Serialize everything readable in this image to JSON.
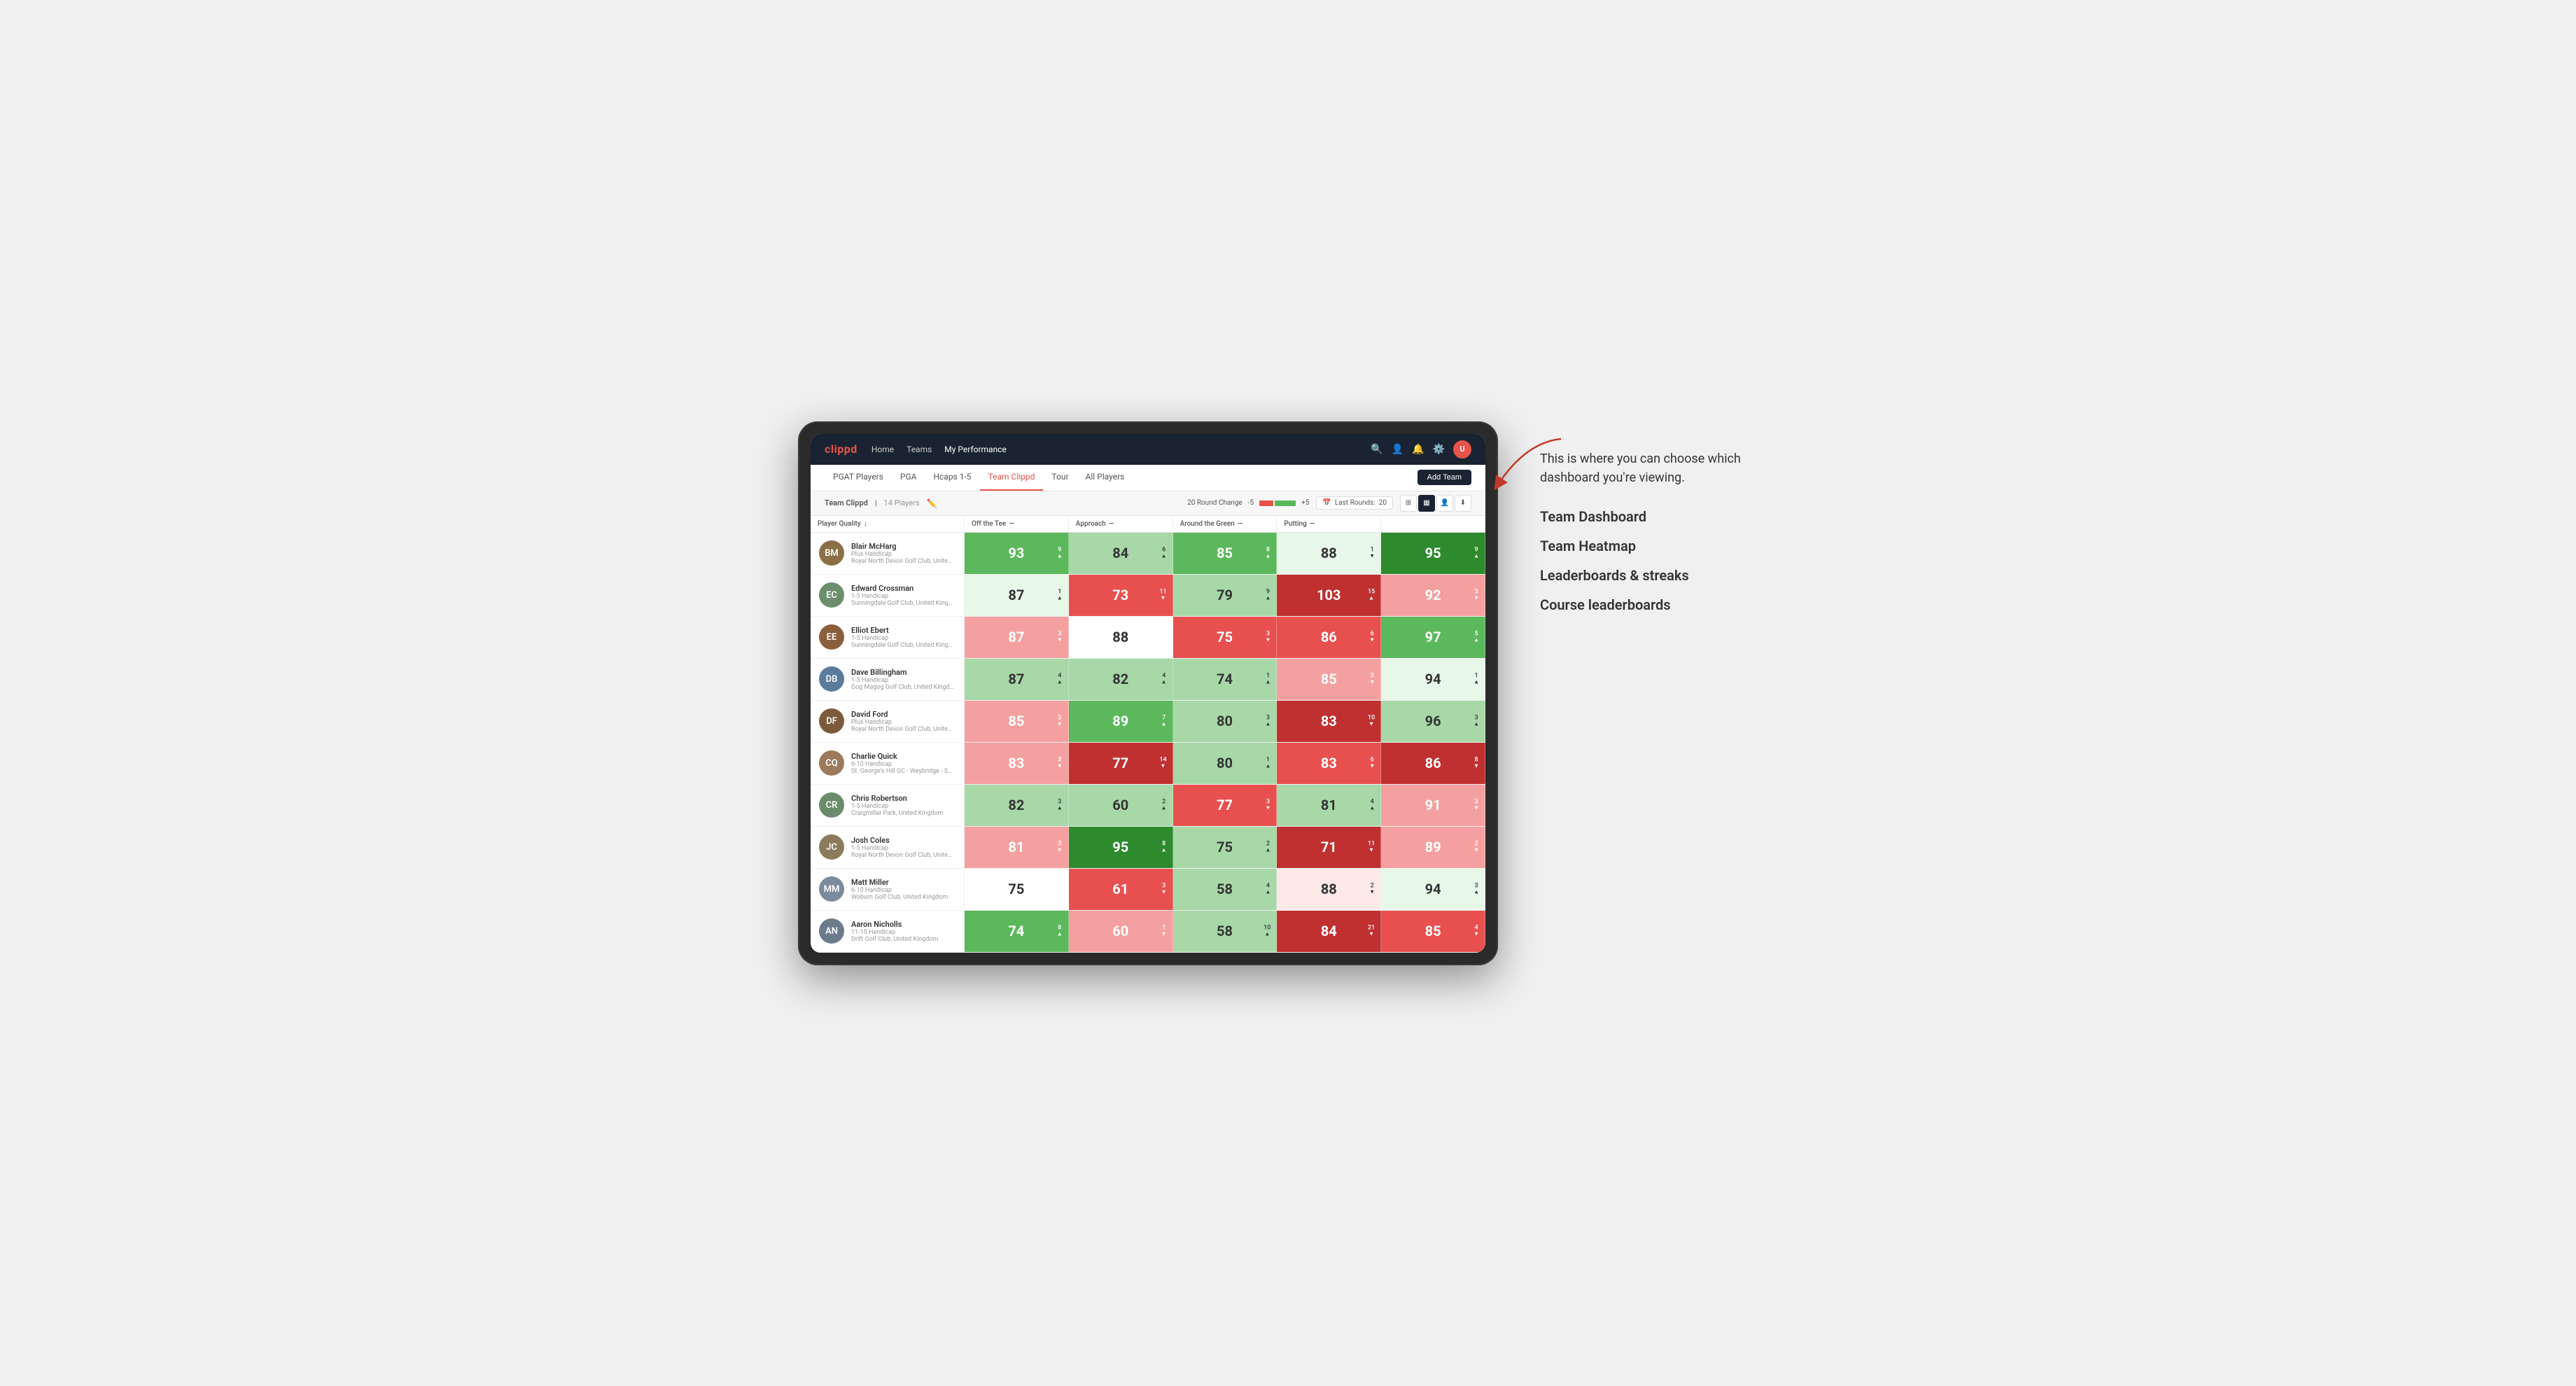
{
  "annotation": {
    "intro": "This is where you can choose which dashboard you're viewing.",
    "items": [
      "Team Dashboard",
      "Team Heatmap",
      "Leaderboards & streaks",
      "Course leaderboards"
    ]
  },
  "nav": {
    "logo": "clippd",
    "links": [
      "Home",
      "Teams",
      "My Performance"
    ],
    "active_link": "My Performance"
  },
  "sub_nav": {
    "links": [
      "PGAT Players",
      "PGA",
      "Hcaps 1-5",
      "Team Clippd",
      "Tour",
      "All Players"
    ],
    "active": "Team Clippd",
    "add_team": "Add Team"
  },
  "table_header": {
    "team_label": "Team Clippd",
    "separator": "|",
    "count": "14 Players",
    "round_change_label": "20 Round Change",
    "change_minus": "-5",
    "change_plus": "+5",
    "last_rounds_label": "Last Rounds:",
    "last_rounds_value": "20"
  },
  "col_headers": [
    {
      "label": "Player Quality",
      "arrow": "↓"
    },
    {
      "label": "Off the Tee",
      "arrow": "—"
    },
    {
      "label": "Approach",
      "arrow": "—"
    },
    {
      "label": "Around the Green",
      "arrow": "—"
    },
    {
      "label": "Putting",
      "arrow": "—"
    }
  ],
  "players": [
    {
      "name": "Blair McHarg",
      "hcap": "Plus Handicap",
      "club": "Royal North Devon Golf Club, United Kingdom",
      "initials": "BM",
      "color": "#8B6F47",
      "scores": [
        {
          "val": "93",
          "change": "9",
          "dir": "up",
          "bg": "green-medium"
        },
        {
          "val": "84",
          "change": "6",
          "dir": "up",
          "bg": "green-light"
        },
        {
          "val": "85",
          "change": "8",
          "dir": "up",
          "bg": "green-medium"
        },
        {
          "val": "88",
          "change": "1",
          "dir": "down",
          "bg": "light-green"
        },
        {
          "val": "95",
          "change": "9",
          "dir": "up",
          "bg": "green-dark"
        }
      ]
    },
    {
      "name": "Edward Crossman",
      "hcap": "1-5 Handicap",
      "club": "Sunningdale Golf Club, United Kingdom",
      "initials": "EC",
      "color": "#6B8E6B",
      "scores": [
        {
          "val": "87",
          "change": "1",
          "dir": "up",
          "bg": "light-green"
        },
        {
          "val": "73",
          "change": "11",
          "dir": "down",
          "bg": "red-medium"
        },
        {
          "val": "79",
          "change": "9",
          "dir": "up",
          "bg": "green-light"
        },
        {
          "val": "103",
          "change": "15",
          "dir": "up",
          "bg": "red-dark"
        },
        {
          "val": "92",
          "change": "3",
          "dir": "down",
          "bg": "red-light"
        }
      ]
    },
    {
      "name": "Elliot Ebert",
      "hcap": "1-5 Handicap",
      "club": "Sunningdale Golf Club, United Kingdom",
      "initials": "EE",
      "color": "#8B5E3C",
      "scores": [
        {
          "val": "87",
          "change": "3",
          "dir": "down",
          "bg": "red-light"
        },
        {
          "val": "88",
          "change": "",
          "dir": "",
          "bg": "white"
        },
        {
          "val": "75",
          "change": "3",
          "dir": "down",
          "bg": "red-medium"
        },
        {
          "val": "86",
          "change": "6",
          "dir": "down",
          "bg": "red-medium"
        },
        {
          "val": "97",
          "change": "5",
          "dir": "up",
          "bg": "green-medium"
        }
      ]
    },
    {
      "name": "Dave Billingham",
      "hcap": "1-5 Handicap",
      "club": "Gog Magog Golf Club, United Kingdom",
      "initials": "DB",
      "color": "#5B7B9B",
      "scores": [
        {
          "val": "87",
          "change": "4",
          "dir": "up",
          "bg": "green-light"
        },
        {
          "val": "82",
          "change": "4",
          "dir": "up",
          "bg": "green-light"
        },
        {
          "val": "74",
          "change": "1",
          "dir": "up",
          "bg": "green-light"
        },
        {
          "val": "85",
          "change": "3",
          "dir": "down",
          "bg": "red-light"
        },
        {
          "val": "94",
          "change": "1",
          "dir": "up",
          "bg": "light-green"
        }
      ]
    },
    {
      "name": "David Ford",
      "hcap": "Plus Handicap",
      "club": "Royal North Devon Golf Club, United Kingdom",
      "initials": "DF",
      "color": "#7B5B3C",
      "scores": [
        {
          "val": "85",
          "change": "3",
          "dir": "down",
          "bg": "red-light"
        },
        {
          "val": "89",
          "change": "7",
          "dir": "up",
          "bg": "green-medium"
        },
        {
          "val": "80",
          "change": "3",
          "dir": "up",
          "bg": "green-light"
        },
        {
          "val": "83",
          "change": "10",
          "dir": "down",
          "bg": "red-dark"
        },
        {
          "val": "96",
          "change": "3",
          "dir": "up",
          "bg": "green-light"
        }
      ]
    },
    {
      "name": "Charlie Quick",
      "hcap": "6-10 Handicap",
      "club": "St. George's Hill GC - Weybridge - Surrey, Uni...",
      "initials": "CQ",
      "color": "#9B7B5B",
      "scores": [
        {
          "val": "83",
          "change": "3",
          "dir": "down",
          "bg": "red-light"
        },
        {
          "val": "77",
          "change": "14",
          "dir": "down",
          "bg": "red-dark"
        },
        {
          "val": "80",
          "change": "1",
          "dir": "up",
          "bg": "green-light"
        },
        {
          "val": "83",
          "change": "6",
          "dir": "down",
          "bg": "red-medium"
        },
        {
          "val": "86",
          "change": "8",
          "dir": "down",
          "bg": "red-dark"
        }
      ]
    },
    {
      "name": "Chris Robertson",
      "hcap": "1-5 Handicap",
      "club": "Craigmillar Park, United Kingdom",
      "initials": "CR",
      "color": "#6B8B6B",
      "scores": [
        {
          "val": "82",
          "change": "3",
          "dir": "up",
          "bg": "green-light"
        },
        {
          "val": "60",
          "change": "2",
          "dir": "up",
          "bg": "green-light"
        },
        {
          "val": "77",
          "change": "3",
          "dir": "down",
          "bg": "red-medium"
        },
        {
          "val": "81",
          "change": "4",
          "dir": "up",
          "bg": "green-light"
        },
        {
          "val": "91",
          "change": "3",
          "dir": "down",
          "bg": "red-light"
        }
      ]
    },
    {
      "name": "Josh Coles",
      "hcap": "1-5 Handicap",
      "club": "Royal North Devon Golf Club, United Kingdom",
      "initials": "JC",
      "color": "#8B7B5B",
      "scores": [
        {
          "val": "81",
          "change": "3",
          "dir": "down",
          "bg": "red-light"
        },
        {
          "val": "95",
          "change": "8",
          "dir": "up",
          "bg": "green-dark"
        },
        {
          "val": "75",
          "change": "2",
          "dir": "up",
          "bg": "green-light"
        },
        {
          "val": "71",
          "change": "11",
          "dir": "down",
          "bg": "red-dark"
        },
        {
          "val": "89",
          "change": "2",
          "dir": "down",
          "bg": "red-light"
        }
      ]
    },
    {
      "name": "Matt Miller",
      "hcap": "6-10 Handicap",
      "club": "Woburn Golf Club, United Kingdom",
      "initials": "MM",
      "color": "#7B8B9B",
      "scores": [
        {
          "val": "75",
          "change": "",
          "dir": "",
          "bg": "white"
        },
        {
          "val": "61",
          "change": "3",
          "dir": "down",
          "bg": "red-medium"
        },
        {
          "val": "58",
          "change": "4",
          "dir": "up",
          "bg": "green-light"
        },
        {
          "val": "88",
          "change": "2",
          "dir": "down",
          "bg": "light-pink"
        },
        {
          "val": "94",
          "change": "3",
          "dir": "up",
          "bg": "light-green"
        }
      ]
    },
    {
      "name": "Aaron Nicholls",
      "hcap": "11-15 Handicap",
      "club": "Drift Golf Club, United Kingdom",
      "initials": "AN",
      "color": "#6B7B8B",
      "scores": [
        {
          "val": "74",
          "change": "8",
          "dir": "up",
          "bg": "green-medium"
        },
        {
          "val": "60",
          "change": "1",
          "dir": "down",
          "bg": "red-light"
        },
        {
          "val": "58",
          "change": "10",
          "dir": "up",
          "bg": "green-light"
        },
        {
          "val": "84",
          "change": "21",
          "dir": "down",
          "bg": "red-dark"
        },
        {
          "val": "85",
          "change": "4",
          "dir": "down",
          "bg": "red-medium"
        }
      ]
    }
  ]
}
